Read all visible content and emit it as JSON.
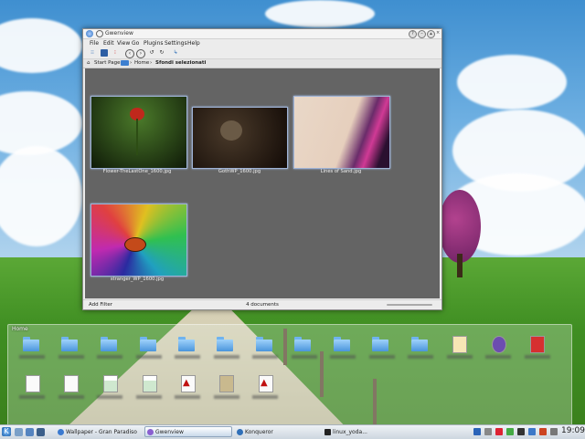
{
  "window": {
    "title": "Gwenview",
    "menu": [
      "File",
      "Edit",
      "View",
      "Go",
      "Plugins",
      "Settings",
      "Help"
    ],
    "breadcrumb": {
      "start_page": "Start Page",
      "home": "Home",
      "current": "Sfondi selezionati"
    },
    "thumbnails": [
      {
        "caption": "Flower-TheLastOne_1600.jpg"
      },
      {
        "caption": "GothWP_1600.jpg"
      },
      {
        "caption": "Lines of Sand.jpg"
      },
      {
        "caption": "stranger_WP_1600.jpg"
      }
    ],
    "status": {
      "add_filter": "Add Filter",
      "count": "4 documents"
    }
  },
  "folderview": {
    "title": "Home"
  },
  "taskbar": {
    "tasks": [
      "Wallpaper - Gran Paradiso",
      "Gwenview",
      "Konqueror",
      "linux_yoda..."
    ],
    "clock": "19:09"
  }
}
